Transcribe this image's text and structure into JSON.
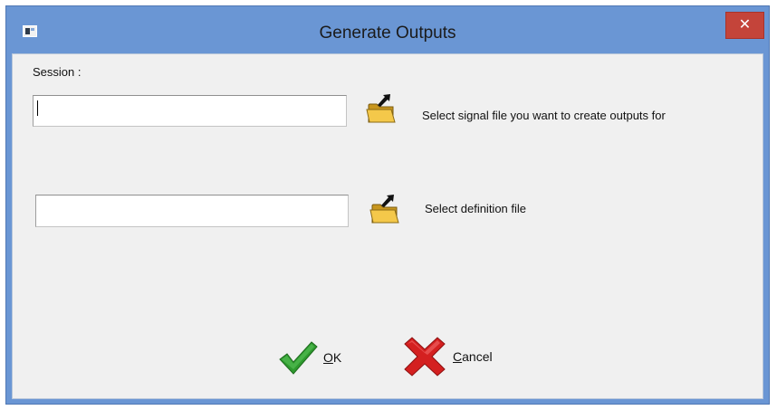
{
  "window": {
    "title": "Generate Outputs",
    "close_glyph": "✕"
  },
  "session": {
    "label": "Session :",
    "signal_file_value": "",
    "signal_file_hint": "Select signal file you want to create outputs for",
    "definition_file_value": "",
    "definition_file_hint": "Select definition file"
  },
  "buttons": {
    "ok_accel": "O",
    "ok_rest": "K",
    "cancel_accel": "C",
    "cancel_rest": "ancel"
  },
  "icons": {
    "app": "app-window-icon",
    "browse": "open-folder-icon",
    "ok": "green-checkmark-icon",
    "cancel": "red-x-icon"
  },
  "colors": {
    "titlebar": "#6a96d4",
    "close": "#c4443a",
    "client_bg": "#f0f0f0",
    "ok_green": "#2e9a2e",
    "cancel_red": "#d42020",
    "folder_yellow": "#f4c84a"
  }
}
